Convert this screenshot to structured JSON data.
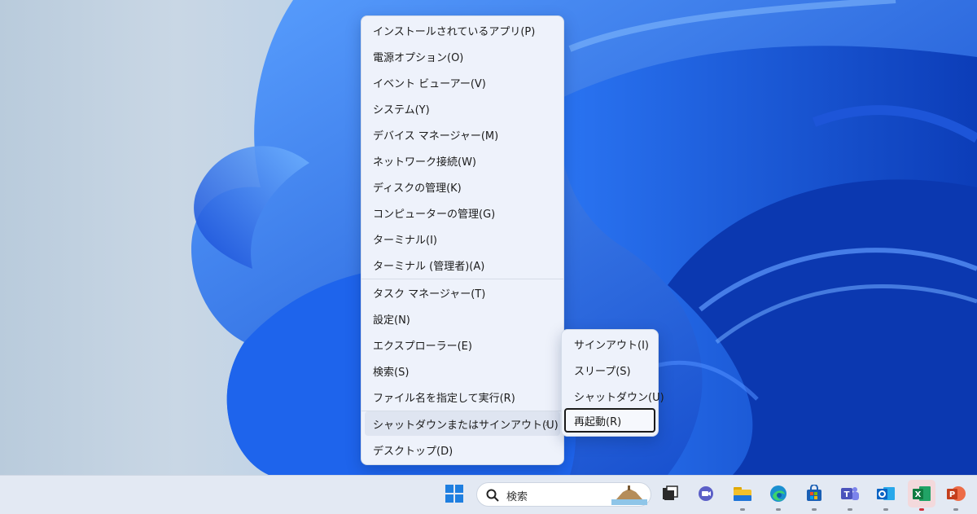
{
  "context_menu": {
    "items": [
      {
        "label": "インストールされているアプリ(P)"
      },
      {
        "label": "電源オプション(O)"
      },
      {
        "label": "イベント ビューアー(V)"
      },
      {
        "label": "システム(Y)"
      },
      {
        "label": "デバイス マネージャー(M)"
      },
      {
        "label": "ネットワーク接続(W)"
      },
      {
        "label": "ディスクの管理(K)"
      },
      {
        "label": "コンピューターの管理(G)"
      },
      {
        "label": "ターミナル(I)"
      },
      {
        "label": "ターミナル (管理者)(A)"
      },
      {
        "label": "タスク マネージャー(T)"
      },
      {
        "label": "設定(N)"
      },
      {
        "label": "エクスプローラー(E)"
      },
      {
        "label": "検索(S)"
      },
      {
        "label": "ファイル名を指定して実行(R)"
      },
      {
        "label": "シャットダウンまたはサインアウト(U)",
        "chevron": "›"
      },
      {
        "label": "デスクトップ(D)"
      }
    ]
  },
  "submenu": {
    "items": [
      {
        "label": "サインアウト(I)"
      },
      {
        "label": "スリープ(S)"
      },
      {
        "label": "シャットダウン(U)"
      },
      {
        "label": "再起動(R)"
      }
    ]
  },
  "taskbar": {
    "search_placeholder": "検索",
    "icons": [
      "windows-start-icon",
      "search-icon",
      "task-view-icon",
      "chat-icon",
      "file-explorer-icon",
      "edge-icon",
      "store-icon",
      "teams-icon",
      "outlook-icon",
      "excel-icon",
      "powerpoint-icon"
    ]
  }
}
